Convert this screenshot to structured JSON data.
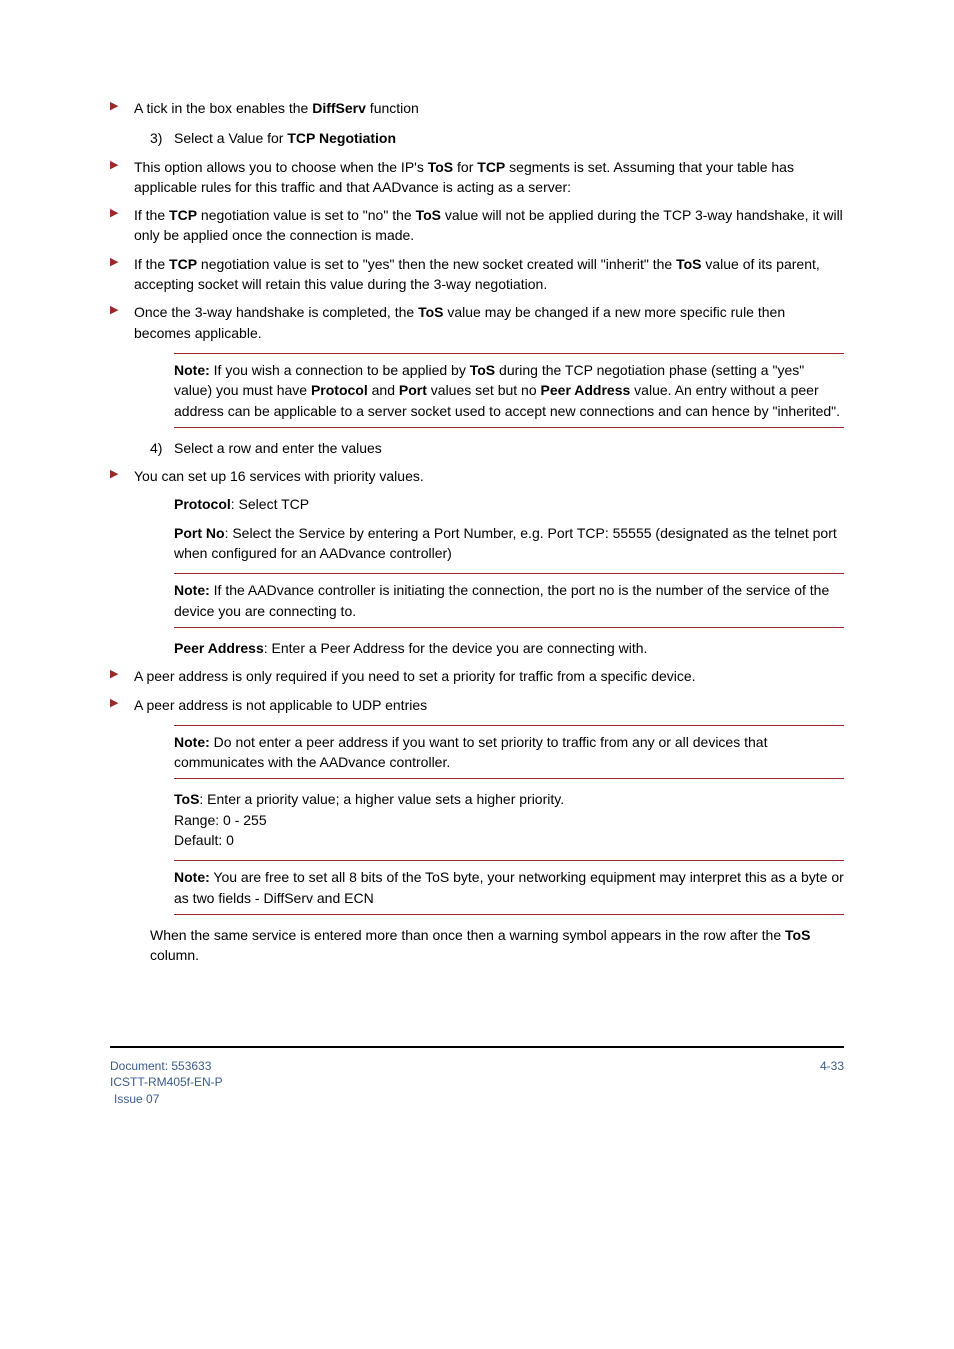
{
  "bullets_top": {
    "b1": "A tick in the box enables the ",
    "b1_bold": "DiffServ",
    "b1_after": " function"
  },
  "step3": {
    "num": "3)",
    "label_pre": "Select a Value for ",
    "label_bold": "TCP Negotiation",
    "b1_pre": "This option allows you to choose when the IP's ",
    "b1_tos": "ToS",
    "b1_mid": " for ",
    "b1_tcp": "TCP",
    "b1_post": " segments is set. Assuming that your table has applicable rules for this traffic and that AADvance is acting as a server:",
    "b2_pre": "If the ",
    "b2_tcp": "TCP",
    "b2_mid": " negotiation value is set to \"no\" the ",
    "b2_tos": "ToS",
    "b2_post": " value will not be applied during the TCP 3-way handshake, it will only be applied once the connection is made.",
    "b3_pre": "If the ",
    "b3_tcp": "TCP",
    "b3_mid": " negotiation value is set to \"yes\" then the new socket created will \"inherit\" the ",
    "b3_tos": "ToS",
    "b3_post": " value of its parent, accepting socket will retain this value during the 3-way negotiation.",
    "b4_pre": "Once the 3-way handshake is completed, the ",
    "b4_tos": "ToS",
    "b4_post": " value may be changed if a new more specific rule then becomes applicable."
  },
  "note1": {
    "bold": "Note:",
    "t1": " If you wish a connection to be applied by ",
    "tos": "ToS",
    "t2": " during the TCP negotiation phase (setting a \"yes\" value) you must have ",
    "proto": "Protocol",
    "t3": " and ",
    "port": "Port",
    "t4": " values set but no ",
    "peer": "Peer Address",
    "t5": " value. An entry without a peer address can be applicable to a server socket used to accept new connections and can hence by \"inherited\"."
  },
  "step4": {
    "num": "4)",
    "label": "Select a row and enter the values",
    "b1": "You can set up 16 services with priority values.",
    "proto_bold": "Protocol",
    "proto_txt": ": Select TCP",
    "portno_bold": "Port No",
    "portno_txt": ": Select the Service by entering a Port Number, e.g. Port TCP: 55555 (designated as the telnet port when configured for an AADvance controller)"
  },
  "note2": {
    "bold": "Note:",
    "t1": " If the AADvance controller is initiating the connection, the port no is the number of the service of the device you are connecting to."
  },
  "peer": {
    "bold": "Peer Address",
    "t1": ": Enter a Peer Address for the device you are connecting with.",
    "b1": "A peer address is only required if you need to set a priority for traffic from a specific device.",
    "b2": "A peer address is not applicable to UDP entries"
  },
  "note3": {
    "bold": "Note:",
    "t1": " Do not enter a peer address if you want to set priority to traffic from any or all devices that communicates with the AADvance controller."
  },
  "tos": {
    "bold": "ToS",
    "t1": ":  Enter a priority value; a higher value sets a higher priority.",
    "range": "Range: 0 - 255",
    "default": "Default: 0"
  },
  "note4": {
    "bold": "Note:",
    "t1": " You are free to set all 8 bits of the ToS byte, your networking equipment may interpret this as a byte or as two fields - DiffServ and ECN"
  },
  "closing": {
    "t1": "When the same service is entered more than once then a warning symbol appears in the row after the ",
    "tos": "ToS",
    "t2": " column."
  },
  "footer": {
    "doc": "Document: 553633",
    "ref": "ICSTT-RM405f-EN-P",
    "issue": "Issue 07",
    "page": "4-33"
  }
}
